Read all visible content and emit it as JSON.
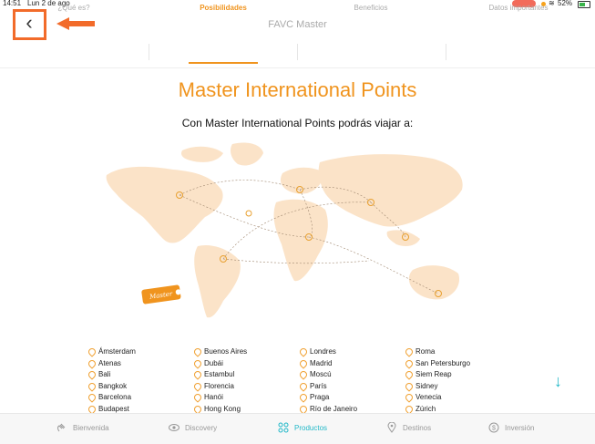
{
  "status": {
    "time": "14:51",
    "date": "Lun 2 de ago",
    "battery": "52%"
  },
  "header": {
    "title": "FAVC Master"
  },
  "tabs": [
    {
      "label": "¿Qué es?"
    },
    {
      "label": "Posibilidades"
    },
    {
      "label": "Beneficios"
    },
    {
      "label": "Datos importantes"
    }
  ],
  "main": {
    "heading": "Master International Points",
    "subtitle": "Con Master International Points podrás viajar a:",
    "luggage_tag": "Master"
  },
  "cities": {
    "col1": [
      "Ámsterdam",
      "Atenas",
      "Bali",
      "Bangkok",
      "Barcelona",
      "Budapest"
    ],
    "col2": [
      "Buenos Aires",
      "Dubái",
      "Estambul",
      "Florencia",
      "Hanói",
      "Hong Kong"
    ],
    "col3": [
      "Londres",
      "Madrid",
      "Moscú",
      "París",
      "Praga",
      "Río de Janeiro"
    ],
    "col4": [
      "Roma",
      "San Petersburgo",
      "Siem Reap",
      "Sidney",
      "Venecia",
      "Zúrich"
    ]
  },
  "bottom_nav": [
    {
      "label": "Bienvenida",
      "icon": "hand-wave-icon"
    },
    {
      "label": "Discovery",
      "icon": "eye-icon"
    },
    {
      "label": "Productos",
      "icon": "grid-icon"
    },
    {
      "label": "Destinos",
      "icon": "map-pin-icon"
    },
    {
      "label": "Inversión",
      "icon": "dollar-icon"
    }
  ],
  "colors": {
    "accent": "#f0941e",
    "teal": "#22b8c8",
    "map": "#fbe3c8"
  }
}
